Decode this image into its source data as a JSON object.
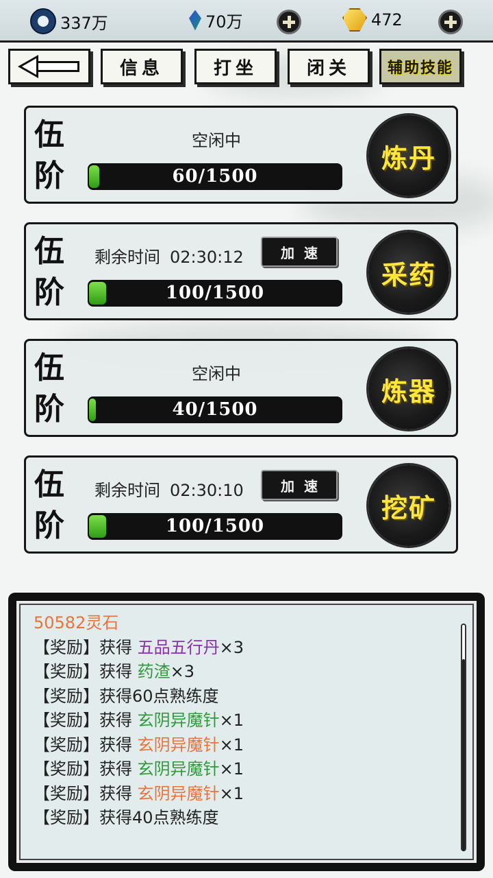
{
  "resources": {
    "spirit_amount": "337万",
    "gem_amount": "70万",
    "gold_amount": "472",
    "spirit_icon": "yin-yang-icon",
    "gem_icon": "blue-crystal-icon",
    "gold_icon": "gold-ingot-icon"
  },
  "tabs": {
    "back_icon": "back-arrow-icon",
    "info": "信息",
    "meditate": "打坐",
    "seclusion": "闭关",
    "assist_skills": "辅助技能"
  },
  "skills": [
    {
      "tier_top": "伍",
      "tier_bottom": "阶",
      "status": "空闲中",
      "timer_label": "",
      "timer_value": "",
      "speed_label": "",
      "progress_text": "60/1500",
      "progress_current": 60,
      "progress_max": 1500,
      "action": "炼丹"
    },
    {
      "tier_top": "伍",
      "tier_bottom": "阶",
      "status": "",
      "timer_label": "剩余时间",
      "timer_value": "02:30:12",
      "speed_label": "加速",
      "progress_text": "100/1500",
      "progress_current": 100,
      "progress_max": 1500,
      "action": "采药"
    },
    {
      "tier_top": "伍",
      "tier_bottom": "阶",
      "status": "空闲中",
      "timer_label": "",
      "timer_value": "",
      "speed_label": "",
      "progress_text": "40/1500",
      "progress_current": 40,
      "progress_max": 1500,
      "action": "炼器"
    },
    {
      "tier_top": "伍",
      "tier_bottom": "阶",
      "status": "",
      "timer_label": "剩余时间",
      "timer_value": "02:30:10",
      "speed_label": "加速",
      "progress_text": "100/1500",
      "progress_current": 100,
      "progress_max": 1500,
      "action": "挖矿"
    }
  ],
  "log": {
    "first_partial": "50582灵石",
    "lines": [
      {
        "prefix": "【奖励】获得 ",
        "item": "五品五行丹",
        "item_color": "purple",
        "suffix": "×3"
      },
      {
        "prefix": "【奖励】获得 ",
        "item": "药渣",
        "item_color": "green",
        "suffix": "×3"
      },
      {
        "prefix": "【奖励】获得60点熟练度",
        "item": "",
        "item_color": "",
        "suffix": ""
      },
      {
        "prefix": "【奖励】获得 ",
        "item": "玄阴异魔针",
        "item_color": "green",
        "suffix": "×1"
      },
      {
        "prefix": "【奖励】获得 ",
        "item": "玄阴异魔针",
        "item_color": "orange",
        "suffix": "×1"
      },
      {
        "prefix": "【奖励】获得 ",
        "item": "玄阴异魔针",
        "item_color": "green",
        "suffix": "×1"
      },
      {
        "prefix": "【奖励】获得 ",
        "item": "玄阴异魔针",
        "item_color": "orange",
        "suffix": "×1"
      },
      {
        "prefix": "【奖励】获得40点熟练度",
        "item": "",
        "item_color": "",
        "suffix": ""
      }
    ]
  },
  "colors": {
    "accent_yellow": "#ffe63a",
    "progress_green": "#3fb51e",
    "item_purple": "#8a2fb0",
    "item_green": "#2f9a3a",
    "item_orange": "#e8743a"
  }
}
